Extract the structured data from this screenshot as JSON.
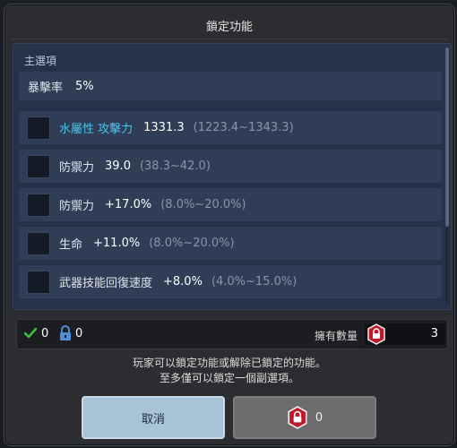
{
  "dialog": {
    "title": "鎖定功能"
  },
  "panel": {
    "header": "主選項",
    "main_stat": {
      "name": "暴擊率",
      "value": "5%"
    },
    "sub_stats": [
      {
        "name": "水屬性 攻擊力",
        "value": "1331.3",
        "range": "(1223.4~1343.3)",
        "highlight": true
      },
      {
        "name": "防禦力",
        "value": "39.0",
        "range": "(38.3~42.0)",
        "highlight": false
      },
      {
        "name": "防禦力",
        "value": "+17.0%",
        "range": "(8.0%~20.0%)",
        "highlight": false
      },
      {
        "name": "生命",
        "value": "+11.0%",
        "range": "(8.0%~20.0%)",
        "highlight": false
      },
      {
        "name": "武器技能回復速度",
        "value": "+8.0%",
        "range": "(4.0%~15.0%)",
        "highlight": false
      }
    ]
  },
  "status": {
    "checked_count": "0",
    "locked_count": "0",
    "own_label": "擁有數量",
    "own_value": "3"
  },
  "info": {
    "line1": "玩家可以鎖定功能或解除已鎖定的功能。",
    "line2": "至多僅可以鎖定一個副選項。"
  },
  "buttons": {
    "cancel": "取消",
    "confirm_cost": "0"
  },
  "icons": {
    "check": "check-icon",
    "lock": "lock-icon",
    "gem": "lock-gem-icon"
  },
  "colors": {
    "highlight": "#4fc3e8",
    "check": "#3bbf3b",
    "lock": "#4f8fd8",
    "gem": "#c0182a"
  }
}
